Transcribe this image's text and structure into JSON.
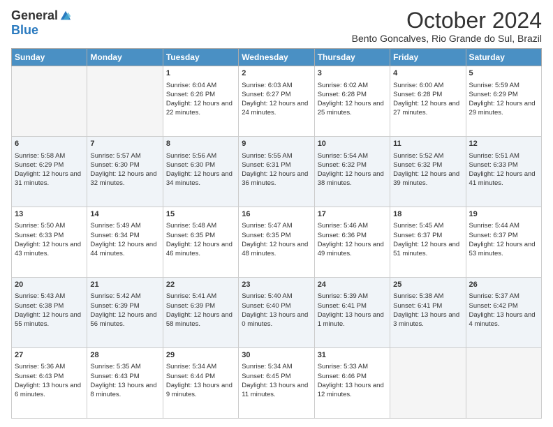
{
  "logo": {
    "general": "General",
    "blue": "Blue"
  },
  "title": "October 2024",
  "location": "Bento Goncalves, Rio Grande do Sul, Brazil",
  "days_of_week": [
    "Sunday",
    "Monday",
    "Tuesday",
    "Wednesday",
    "Thursday",
    "Friday",
    "Saturday"
  ],
  "weeks": [
    {
      "shade": false,
      "days": [
        {
          "num": "",
          "info": ""
        },
        {
          "num": "",
          "info": ""
        },
        {
          "num": "1",
          "info": "Sunrise: 6:04 AM\nSunset: 6:26 PM\nDaylight: 12 hours and 22 minutes."
        },
        {
          "num": "2",
          "info": "Sunrise: 6:03 AM\nSunset: 6:27 PM\nDaylight: 12 hours and 24 minutes."
        },
        {
          "num": "3",
          "info": "Sunrise: 6:02 AM\nSunset: 6:28 PM\nDaylight: 12 hours and 25 minutes."
        },
        {
          "num": "4",
          "info": "Sunrise: 6:00 AM\nSunset: 6:28 PM\nDaylight: 12 hours and 27 minutes."
        },
        {
          "num": "5",
          "info": "Sunrise: 5:59 AM\nSunset: 6:29 PM\nDaylight: 12 hours and 29 minutes."
        }
      ]
    },
    {
      "shade": true,
      "days": [
        {
          "num": "6",
          "info": "Sunrise: 5:58 AM\nSunset: 6:29 PM\nDaylight: 12 hours and 31 minutes."
        },
        {
          "num": "7",
          "info": "Sunrise: 5:57 AM\nSunset: 6:30 PM\nDaylight: 12 hours and 32 minutes."
        },
        {
          "num": "8",
          "info": "Sunrise: 5:56 AM\nSunset: 6:30 PM\nDaylight: 12 hours and 34 minutes."
        },
        {
          "num": "9",
          "info": "Sunrise: 5:55 AM\nSunset: 6:31 PM\nDaylight: 12 hours and 36 minutes."
        },
        {
          "num": "10",
          "info": "Sunrise: 5:54 AM\nSunset: 6:32 PM\nDaylight: 12 hours and 38 minutes."
        },
        {
          "num": "11",
          "info": "Sunrise: 5:52 AM\nSunset: 6:32 PM\nDaylight: 12 hours and 39 minutes."
        },
        {
          "num": "12",
          "info": "Sunrise: 5:51 AM\nSunset: 6:33 PM\nDaylight: 12 hours and 41 minutes."
        }
      ]
    },
    {
      "shade": false,
      "days": [
        {
          "num": "13",
          "info": "Sunrise: 5:50 AM\nSunset: 6:33 PM\nDaylight: 12 hours and 43 minutes."
        },
        {
          "num": "14",
          "info": "Sunrise: 5:49 AM\nSunset: 6:34 PM\nDaylight: 12 hours and 44 minutes."
        },
        {
          "num": "15",
          "info": "Sunrise: 5:48 AM\nSunset: 6:35 PM\nDaylight: 12 hours and 46 minutes."
        },
        {
          "num": "16",
          "info": "Sunrise: 5:47 AM\nSunset: 6:35 PM\nDaylight: 12 hours and 48 minutes."
        },
        {
          "num": "17",
          "info": "Sunrise: 5:46 AM\nSunset: 6:36 PM\nDaylight: 12 hours and 49 minutes."
        },
        {
          "num": "18",
          "info": "Sunrise: 5:45 AM\nSunset: 6:37 PM\nDaylight: 12 hours and 51 minutes."
        },
        {
          "num": "19",
          "info": "Sunrise: 5:44 AM\nSunset: 6:37 PM\nDaylight: 12 hours and 53 minutes."
        }
      ]
    },
    {
      "shade": true,
      "days": [
        {
          "num": "20",
          "info": "Sunrise: 5:43 AM\nSunset: 6:38 PM\nDaylight: 12 hours and 55 minutes."
        },
        {
          "num": "21",
          "info": "Sunrise: 5:42 AM\nSunset: 6:39 PM\nDaylight: 12 hours and 56 minutes."
        },
        {
          "num": "22",
          "info": "Sunrise: 5:41 AM\nSunset: 6:39 PM\nDaylight: 12 hours and 58 minutes."
        },
        {
          "num": "23",
          "info": "Sunrise: 5:40 AM\nSunset: 6:40 PM\nDaylight: 13 hours and 0 minutes."
        },
        {
          "num": "24",
          "info": "Sunrise: 5:39 AM\nSunset: 6:41 PM\nDaylight: 13 hours and 1 minute."
        },
        {
          "num": "25",
          "info": "Sunrise: 5:38 AM\nSunset: 6:41 PM\nDaylight: 13 hours and 3 minutes."
        },
        {
          "num": "26",
          "info": "Sunrise: 5:37 AM\nSunset: 6:42 PM\nDaylight: 13 hours and 4 minutes."
        }
      ]
    },
    {
      "shade": false,
      "days": [
        {
          "num": "27",
          "info": "Sunrise: 5:36 AM\nSunset: 6:43 PM\nDaylight: 13 hours and 6 minutes."
        },
        {
          "num": "28",
          "info": "Sunrise: 5:35 AM\nSunset: 6:43 PM\nDaylight: 13 hours and 8 minutes."
        },
        {
          "num": "29",
          "info": "Sunrise: 5:34 AM\nSunset: 6:44 PM\nDaylight: 13 hours and 9 minutes."
        },
        {
          "num": "30",
          "info": "Sunrise: 5:34 AM\nSunset: 6:45 PM\nDaylight: 13 hours and 11 minutes."
        },
        {
          "num": "31",
          "info": "Sunrise: 5:33 AM\nSunset: 6:46 PM\nDaylight: 13 hours and 12 minutes."
        },
        {
          "num": "",
          "info": ""
        },
        {
          "num": "",
          "info": ""
        }
      ]
    }
  ]
}
